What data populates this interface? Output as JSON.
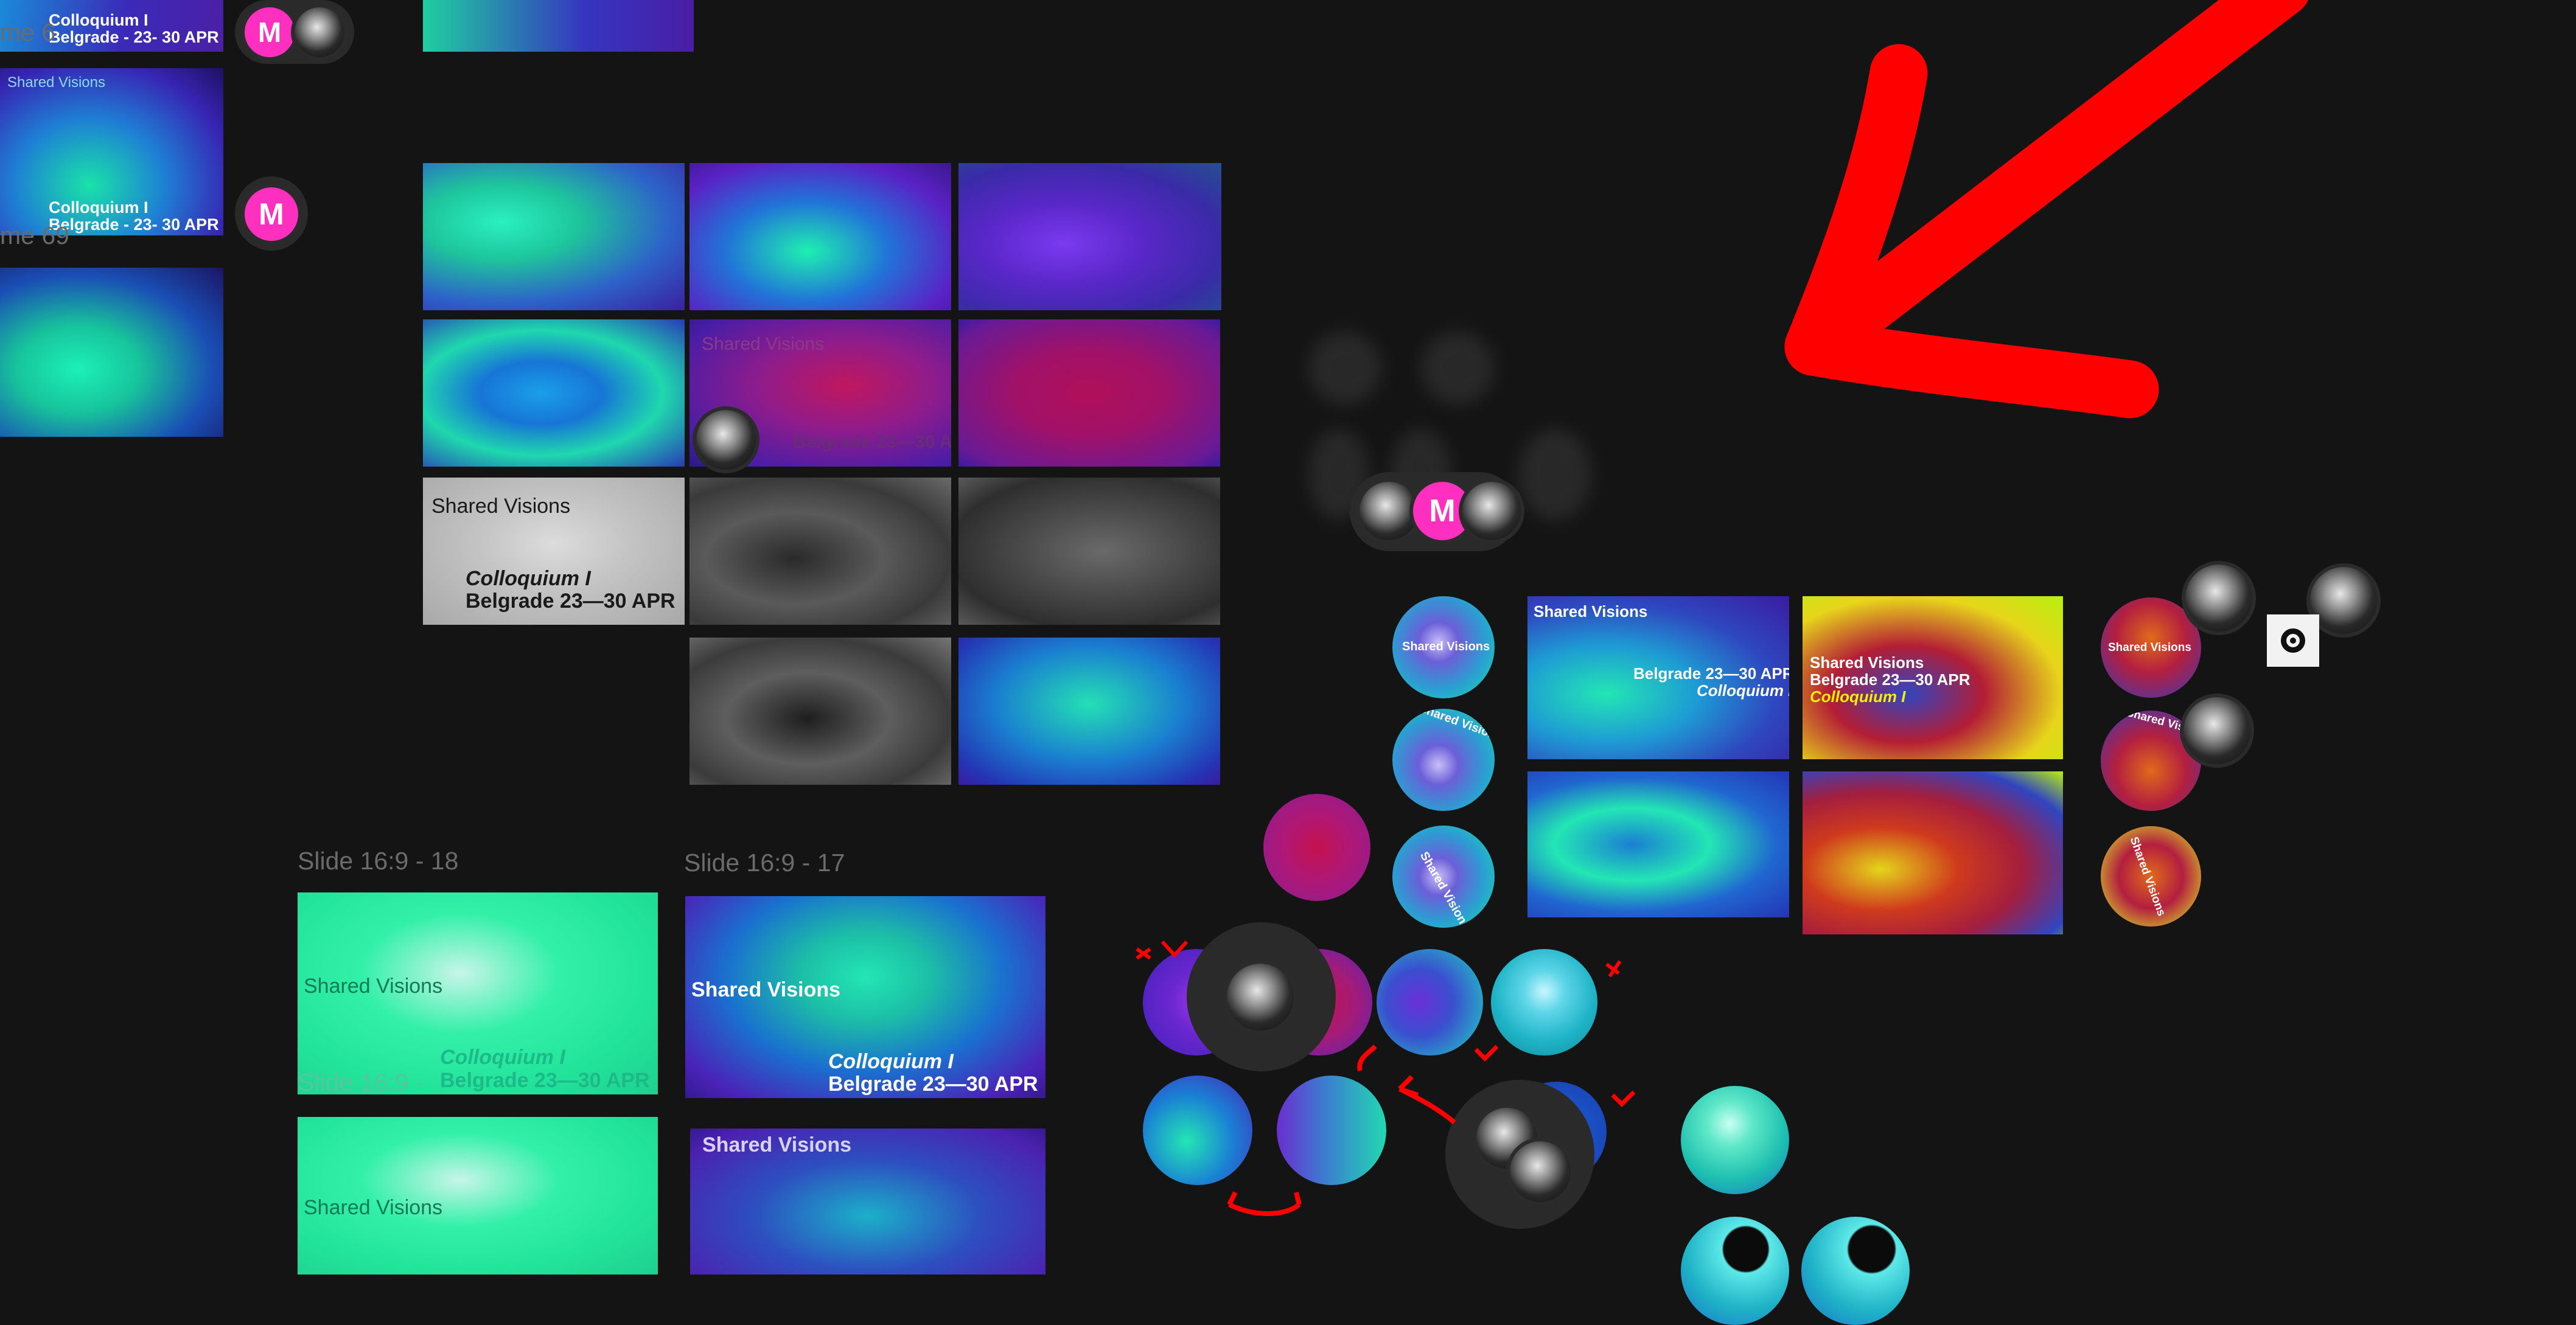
{
  "frames": {
    "top_left_1": {
      "title": "Colloquium I",
      "subtitle": "Belgrade - 23- 30 APR",
      "label": "me 6"
    },
    "top_left_2": {
      "brand": "Shared Visions",
      "title": "Colloquium I",
      "subtitle": "Belgrade - 23- 30 APR",
      "label": "me 69"
    },
    "grid_pink": {
      "brand": "Shared Visions",
      "subtitle": "Belgrade 23—30 APR"
    },
    "grid_gray": {
      "brand": "Shared Visions",
      "title": "Colloquium I",
      "subtitle": "Belgrade 23—30 APR"
    },
    "slide_18": {
      "label": "Slide 16:9 - 18",
      "brand": "Shared Visions",
      "title": "Colloquium I",
      "subtitle": "Belgrade 23—30 APR"
    },
    "slide_17": {
      "label": "Slide 16:9 - 17",
      "brand": "Shared Visions",
      "title": "Colloquium I",
      "subtitle": "Belgrade 23—30 APR"
    },
    "slide_below_18": {
      "label": "Slide 16:9 -",
      "brand": "Shared Visions"
    },
    "slide_below_17": {
      "brand": "Shared Visions"
    },
    "blue_green_card": {
      "brand": "Shared Visions",
      "subtitle": "Belgrade 23—30 APR",
      "title": "Colloquium I"
    },
    "yellow_card": {
      "brand": "Shared Visions",
      "line2": "Belgrade 23—30 APR",
      "title": "Colloquium I"
    }
  },
  "badges": {
    "orb_label": "Shared Visions",
    "orb_label_curved": "Shared Visions"
  },
  "avatars": {
    "m_letter": "M"
  },
  "annotation": {
    "arrow_color": "#ff0000"
  },
  "colors": {
    "canvas": "#141414",
    "accent_pink": "#ff2fbf",
    "annotation_red": "#ff0000"
  }
}
